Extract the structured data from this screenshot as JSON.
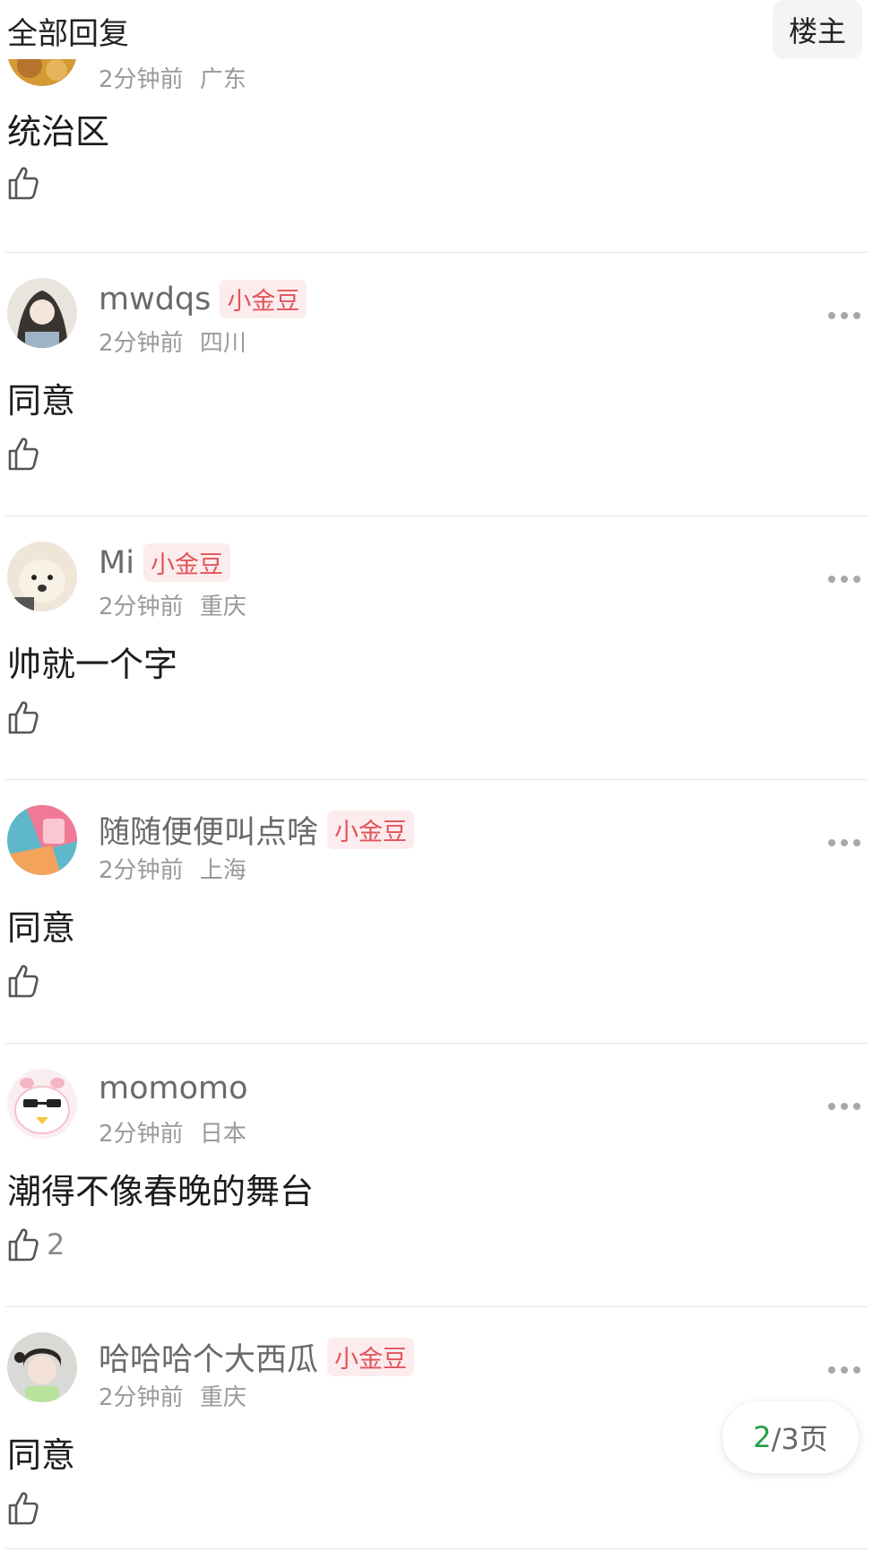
{
  "header": {
    "title": "全部回复",
    "owner_button": "楼主"
  },
  "first_comment": {
    "meta_time": "2分钟前",
    "meta_location": "广东",
    "text": "统治区"
  },
  "comments": [
    {
      "name": "mwdqs",
      "badge": "小金豆",
      "time": "2分钟前",
      "location": "四川",
      "text": "同意",
      "likes": ""
    },
    {
      "name": "Mi",
      "badge": "小金豆",
      "time": "2分钟前",
      "location": "重庆",
      "text": "帅就一个字",
      "likes": ""
    },
    {
      "name": "随随便便叫点啥",
      "badge": "小金豆",
      "time": "2分钟前",
      "location": "上海",
      "text": "同意",
      "likes": ""
    },
    {
      "name": "momomo",
      "badge": "",
      "time": "2分钟前",
      "location": "日本",
      "text": "潮得不像春晚的舞台",
      "likes": "2"
    },
    {
      "name": "哈哈哈个大西瓜",
      "badge": "小金豆",
      "time": "2分钟前",
      "location": "重庆",
      "text": "同意",
      "likes": ""
    }
  ],
  "pager": {
    "current": "2",
    "total_label": "/3页"
  },
  "icons": {
    "like": "thumbs-up-icon",
    "more": "more-dots-icon"
  },
  "colors": {
    "badge_text": "#e0545a",
    "badge_bg": "#fdeced",
    "pager_current": "#23a046"
  }
}
